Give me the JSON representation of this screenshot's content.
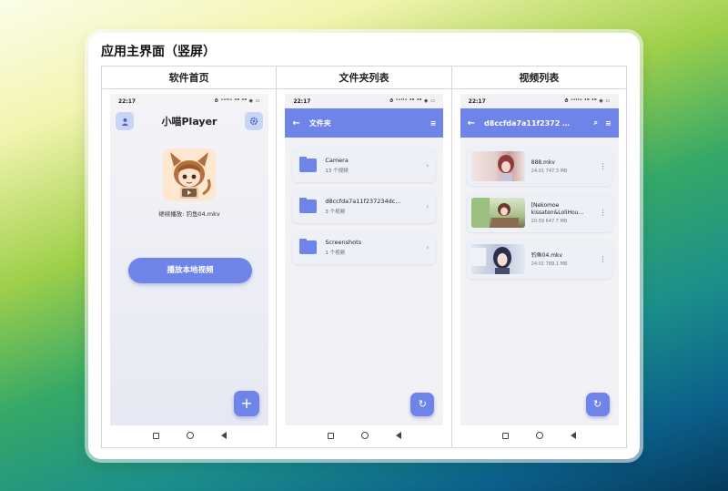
{
  "page": {
    "title": "应用主界面（竖屏）",
    "columns": [
      "软件首页",
      "文件夹列表",
      "视频列表"
    ]
  },
  "status_bar": {
    "time": "22:17",
    "icons": "⏱ ᵛᵒˡᵗᵉ ⁴ᴳ ⁴ᴳ ◉ ▭"
  },
  "home": {
    "title": "小喵Player",
    "continue_text": "继续播放: 钓鱼04.mkv",
    "play_button": "播放本地视频",
    "fab": "+",
    "user_icon": "user-icon",
    "settings_icon": "gear-icon"
  },
  "folders": {
    "title": "文件夹",
    "items": [
      {
        "name": "Camera",
        "count": "13 个视频"
      },
      {
        "name": "d8ccfda7a11f237234dc…",
        "count": "3 个视频"
      },
      {
        "name": "Screenshots",
        "count": "1 个视频"
      }
    ]
  },
  "videos": {
    "title": "d8ccfda7a11f2372 …",
    "items": [
      {
        "name": "888.mkv",
        "meta": "24:01  747.3 MB",
        "thumb_color": "#e8d4d0"
      },
      {
        "name": "[Nekomoe kissaten&LoliHou…",
        "meta": "20:59  647.7 MB",
        "thumb_color": "#c7d8b8"
      },
      {
        "name": "钓鱼04.mkv",
        "meta": "24:01  789.1 MB",
        "thumb_color": "#c8cce0"
      }
    ]
  },
  "colors": {
    "accent": "#6f84e8",
    "card_bg": "#eef0f8"
  }
}
